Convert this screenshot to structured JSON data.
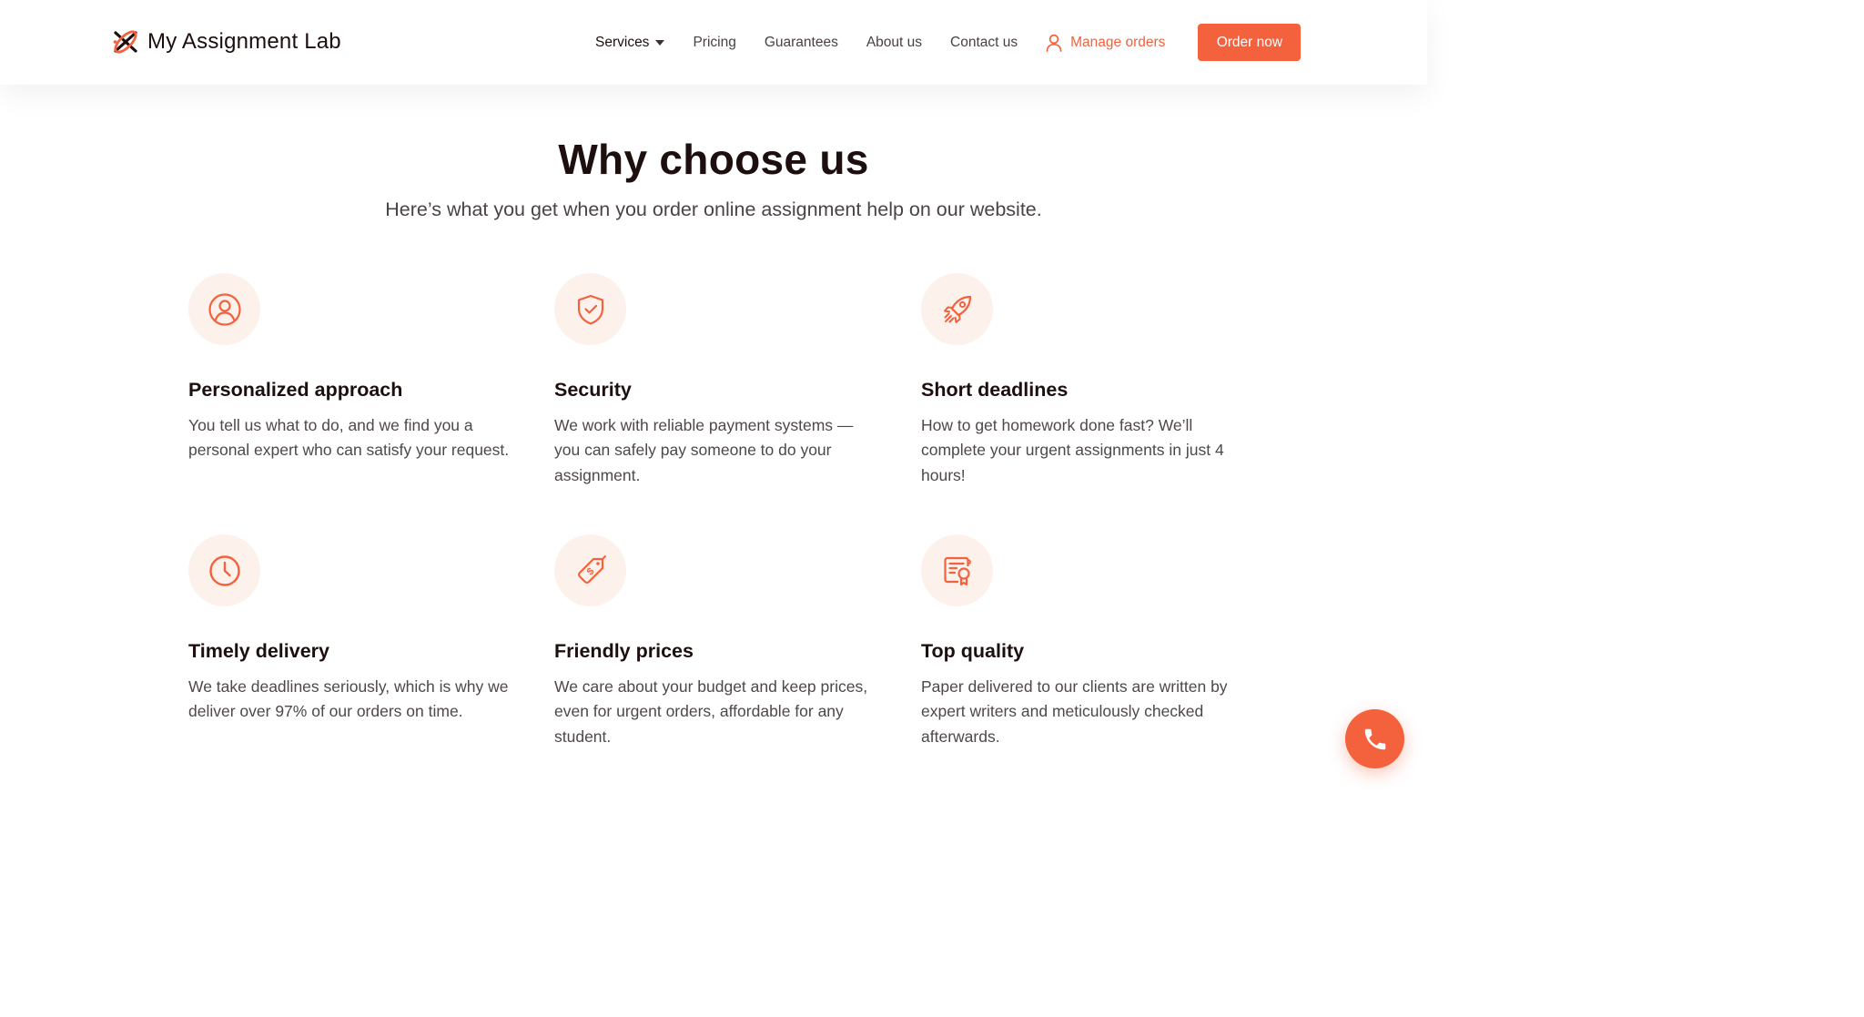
{
  "brand": {
    "name": "My Assignment Lab",
    "accent_color": "#f4613d",
    "icon": "logo-mark-icon"
  },
  "nav": {
    "services_label": "Services",
    "pricing_label": "Pricing",
    "guarantees_label": "Guarantees",
    "about_label": "About us",
    "contact_label": "Contact us",
    "manage_orders_label": "Manage orders",
    "order_now_label": "Order now"
  },
  "section": {
    "title": "Why choose us",
    "subtitle": "Here’s what you get when you order online assignment help on our website."
  },
  "features": [
    {
      "icon": "user-circle-icon",
      "title": "Personalized approach",
      "description": "You tell us what to do, and we find you a personal expert who can satisfy your request."
    },
    {
      "icon": "shield-check-icon",
      "title": "Security",
      "description": "We work with reliable payment systems — you can safely pay someone to do your assignment."
    },
    {
      "icon": "rocket-icon",
      "title": "Short deadlines",
      "description": "How to get homework done fast? We’ll complete your urgent assignments in just 4 hours!"
    },
    {
      "icon": "clock-icon",
      "title": "Timely delivery",
      "description": "We take deadlines seriously, which is why we deliver over 97% of our orders on time."
    },
    {
      "icon": "price-tag-icon",
      "title": "Friendly prices",
      "description": "We care about your budget and keep prices, even for urgent orders, affordable for any student."
    },
    {
      "icon": "certificate-icon",
      "title": "Top quality",
      "description": "Paper delivered to our clients are written by expert writers and meticulously checked afterwards."
    }
  ],
  "floating": {
    "icon": "phone-icon"
  }
}
